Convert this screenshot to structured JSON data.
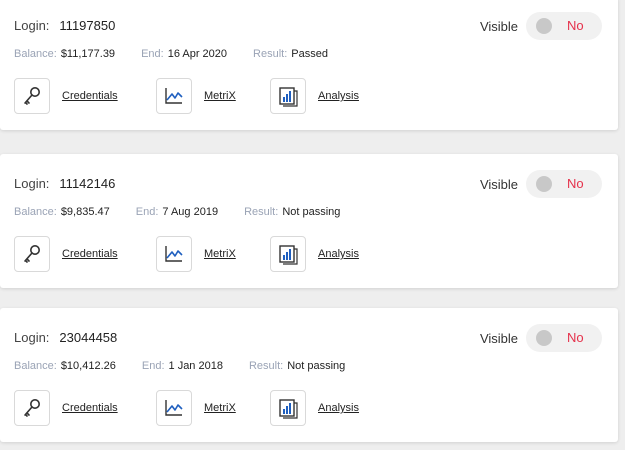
{
  "labels": {
    "login": "Login:",
    "visible": "Visible",
    "balance": "Balance:",
    "end": "End:",
    "result": "Result:"
  },
  "actions": {
    "credentials": "Credentials",
    "metrix": "MetriX",
    "analysis": "Analysis"
  },
  "icons": {
    "credentials": "key-icon",
    "metrix": "line-chart-icon",
    "analysis": "bar-chart-report-icon"
  },
  "colors": {
    "passed": "#19b899",
    "not_passing": "#e5314b",
    "toggle_off_text": "#e5314b",
    "meta_label": "#9aa3b5",
    "icon_blue": "#1f5fbf"
  },
  "accounts": [
    {
      "login": "11197850",
      "visible_state": "No",
      "balance": "$11,177.39",
      "end": "16 Apr 2020",
      "result": "Passed",
      "result_status": "passed"
    },
    {
      "login": "11142146",
      "visible_state": "No",
      "balance": "$9,835.47",
      "end": "7 Aug 2019",
      "result": "Not passing",
      "result_status": "fail"
    },
    {
      "login": "23044458",
      "visible_state": "No",
      "balance": "$10,412.26",
      "end": "1 Jan 2018",
      "result": "Not passing",
      "result_status": "fail"
    }
  ]
}
